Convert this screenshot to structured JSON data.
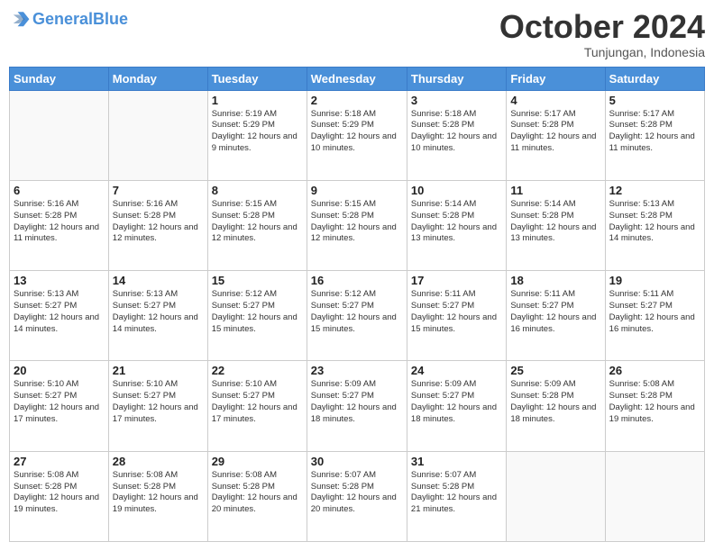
{
  "header": {
    "logo_general": "General",
    "logo_blue": "Blue",
    "month": "October 2024",
    "location": "Tunjungan, Indonesia"
  },
  "weekdays": [
    "Sunday",
    "Monday",
    "Tuesday",
    "Wednesday",
    "Thursday",
    "Friday",
    "Saturday"
  ],
  "weeks": [
    [
      {
        "day": "",
        "info": ""
      },
      {
        "day": "",
        "info": ""
      },
      {
        "day": "1",
        "info": "Sunrise: 5:19 AM\nSunset: 5:29 PM\nDaylight: 12 hours and 9 minutes."
      },
      {
        "day": "2",
        "info": "Sunrise: 5:18 AM\nSunset: 5:29 PM\nDaylight: 12 hours and 10 minutes."
      },
      {
        "day": "3",
        "info": "Sunrise: 5:18 AM\nSunset: 5:28 PM\nDaylight: 12 hours and 10 minutes."
      },
      {
        "day": "4",
        "info": "Sunrise: 5:17 AM\nSunset: 5:28 PM\nDaylight: 12 hours and 11 minutes."
      },
      {
        "day": "5",
        "info": "Sunrise: 5:17 AM\nSunset: 5:28 PM\nDaylight: 12 hours and 11 minutes."
      }
    ],
    [
      {
        "day": "6",
        "info": "Sunrise: 5:16 AM\nSunset: 5:28 PM\nDaylight: 12 hours and 11 minutes."
      },
      {
        "day": "7",
        "info": "Sunrise: 5:16 AM\nSunset: 5:28 PM\nDaylight: 12 hours and 12 minutes."
      },
      {
        "day": "8",
        "info": "Sunrise: 5:15 AM\nSunset: 5:28 PM\nDaylight: 12 hours and 12 minutes."
      },
      {
        "day": "9",
        "info": "Sunrise: 5:15 AM\nSunset: 5:28 PM\nDaylight: 12 hours and 12 minutes."
      },
      {
        "day": "10",
        "info": "Sunrise: 5:14 AM\nSunset: 5:28 PM\nDaylight: 12 hours and 13 minutes."
      },
      {
        "day": "11",
        "info": "Sunrise: 5:14 AM\nSunset: 5:28 PM\nDaylight: 12 hours and 13 minutes."
      },
      {
        "day": "12",
        "info": "Sunrise: 5:13 AM\nSunset: 5:28 PM\nDaylight: 12 hours and 14 minutes."
      }
    ],
    [
      {
        "day": "13",
        "info": "Sunrise: 5:13 AM\nSunset: 5:27 PM\nDaylight: 12 hours and 14 minutes."
      },
      {
        "day": "14",
        "info": "Sunrise: 5:13 AM\nSunset: 5:27 PM\nDaylight: 12 hours and 14 minutes."
      },
      {
        "day": "15",
        "info": "Sunrise: 5:12 AM\nSunset: 5:27 PM\nDaylight: 12 hours and 15 minutes."
      },
      {
        "day": "16",
        "info": "Sunrise: 5:12 AM\nSunset: 5:27 PM\nDaylight: 12 hours and 15 minutes."
      },
      {
        "day": "17",
        "info": "Sunrise: 5:11 AM\nSunset: 5:27 PM\nDaylight: 12 hours and 15 minutes."
      },
      {
        "day": "18",
        "info": "Sunrise: 5:11 AM\nSunset: 5:27 PM\nDaylight: 12 hours and 16 minutes."
      },
      {
        "day": "19",
        "info": "Sunrise: 5:11 AM\nSunset: 5:27 PM\nDaylight: 12 hours and 16 minutes."
      }
    ],
    [
      {
        "day": "20",
        "info": "Sunrise: 5:10 AM\nSunset: 5:27 PM\nDaylight: 12 hours and 17 minutes."
      },
      {
        "day": "21",
        "info": "Sunrise: 5:10 AM\nSunset: 5:27 PM\nDaylight: 12 hours and 17 minutes."
      },
      {
        "day": "22",
        "info": "Sunrise: 5:10 AM\nSunset: 5:27 PM\nDaylight: 12 hours and 17 minutes."
      },
      {
        "day": "23",
        "info": "Sunrise: 5:09 AM\nSunset: 5:27 PM\nDaylight: 12 hours and 18 minutes."
      },
      {
        "day": "24",
        "info": "Sunrise: 5:09 AM\nSunset: 5:27 PM\nDaylight: 12 hours and 18 minutes."
      },
      {
        "day": "25",
        "info": "Sunrise: 5:09 AM\nSunset: 5:28 PM\nDaylight: 12 hours and 18 minutes."
      },
      {
        "day": "26",
        "info": "Sunrise: 5:08 AM\nSunset: 5:28 PM\nDaylight: 12 hours and 19 minutes."
      }
    ],
    [
      {
        "day": "27",
        "info": "Sunrise: 5:08 AM\nSunset: 5:28 PM\nDaylight: 12 hours and 19 minutes."
      },
      {
        "day": "28",
        "info": "Sunrise: 5:08 AM\nSunset: 5:28 PM\nDaylight: 12 hours and 19 minutes."
      },
      {
        "day": "29",
        "info": "Sunrise: 5:08 AM\nSunset: 5:28 PM\nDaylight: 12 hours and 20 minutes."
      },
      {
        "day": "30",
        "info": "Sunrise: 5:07 AM\nSunset: 5:28 PM\nDaylight: 12 hours and 20 minutes."
      },
      {
        "day": "31",
        "info": "Sunrise: 5:07 AM\nSunset: 5:28 PM\nDaylight: 12 hours and 21 minutes."
      },
      {
        "day": "",
        "info": ""
      },
      {
        "day": "",
        "info": ""
      }
    ]
  ]
}
